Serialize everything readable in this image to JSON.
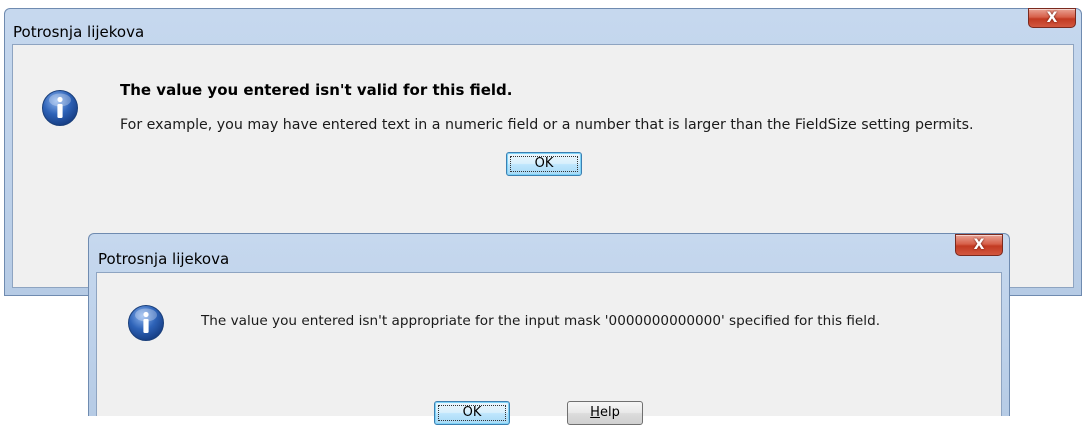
{
  "dialog1": {
    "title": "Potrosnja lijekova",
    "close_label": "X",
    "icon": "info-icon",
    "heading": "The value you entered isn't valid for this field.",
    "message": "For example, you may have entered text in a numeric field or a number that is larger than the FieldSize setting permits.",
    "ok_label": "OK"
  },
  "dialog2": {
    "title": "Potrosnja lijekova",
    "close_label": "X",
    "icon": "info-icon",
    "message": "The value you entered isn't appropriate for the input mask '0000000000000' specified for this field.",
    "ok_label": "OK",
    "help_mnemonic": "H",
    "help_rest": "elp"
  },
  "colors": {
    "titlebar": "#c0d4ec",
    "client": "#f0f0f0",
    "close_button": "#c8442c",
    "icon_blue": "#2e63b8"
  }
}
